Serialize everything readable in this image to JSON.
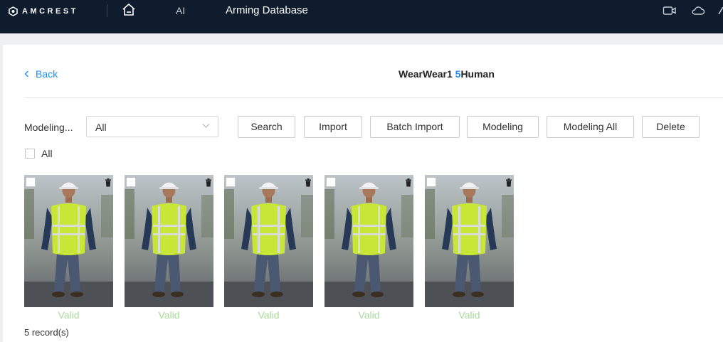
{
  "topbar": {
    "brand": "AMCREST",
    "nav_ai": "AI",
    "nav_title": "Arming Database",
    "icons": [
      "logo-icon",
      "home-icon",
      "camera-icon",
      "cloud-icon"
    ]
  },
  "header": {
    "back_label": "Back",
    "title_prefix": "WearWear1 ",
    "title_count": "5",
    "title_suffix": "Human"
  },
  "filter": {
    "label": "Modeling...",
    "selected": "All"
  },
  "toolbar": {
    "search": "Search",
    "import": "Import",
    "batch_import": "Batch Import",
    "modeling": "Modeling",
    "modeling_all": "Modeling All",
    "delete": "Delete"
  },
  "select_all_label": "All",
  "cards": [
    {
      "status": "Valid"
    },
    {
      "status": "Valid"
    },
    {
      "status": "Valid"
    },
    {
      "status": "Valid"
    },
    {
      "status": "Valid"
    }
  ],
  "records": "5 record(s)",
  "colors": {
    "topbar": "#0e1c2e",
    "accent": "#1890ff",
    "valid": "#a9d99b",
    "vest": "#c8e635"
  }
}
